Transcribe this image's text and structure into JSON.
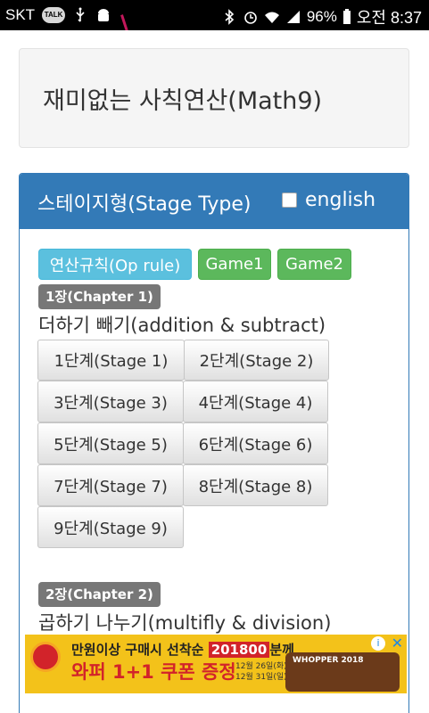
{
  "status_bar": {
    "carrier": "SKT",
    "talk_badge": "TALK",
    "battery": "96%",
    "time": "오전 8:37"
  },
  "header": {
    "title": "재미없는 사칙연산(Math9)"
  },
  "panel": {
    "title": "스테이지형(Stage Type)",
    "english_label": "english",
    "buttons": {
      "op_rule": "연산규칙(Op rule)",
      "game1": "Game1",
      "game2": "Game2"
    }
  },
  "chapters": [
    {
      "badge": "1장(Chapter 1)",
      "subtitle": "더하기 빼기(addition & subtract)",
      "stages": [
        "1단계(Stage 1)",
        "2단계(Stage 2)",
        "3단계(Stage 3)",
        "4단계(Stage 4)",
        "5단계(Stage 5)",
        "6단계(Stage 6)",
        "7단계(Stage 7)",
        "8단계(Stage 8)",
        "9단계(Stage 9)"
      ]
    },
    {
      "badge": "2장(Chapter 2)",
      "subtitle": "곱하기 나누기(multifly & division)"
    }
  ],
  "ad": {
    "line1_a": "만원이상 구매시 선착순",
    "line1_hl": "201800",
    "line1_b": "분께",
    "line2": "와퍼 1+1 쿠폰 증정",
    "date1": "12월 26일(화)~",
    "date2": "12월 31일(일)",
    "whopper": "WHOPPER 2018",
    "info": "i",
    "close": "✕"
  }
}
